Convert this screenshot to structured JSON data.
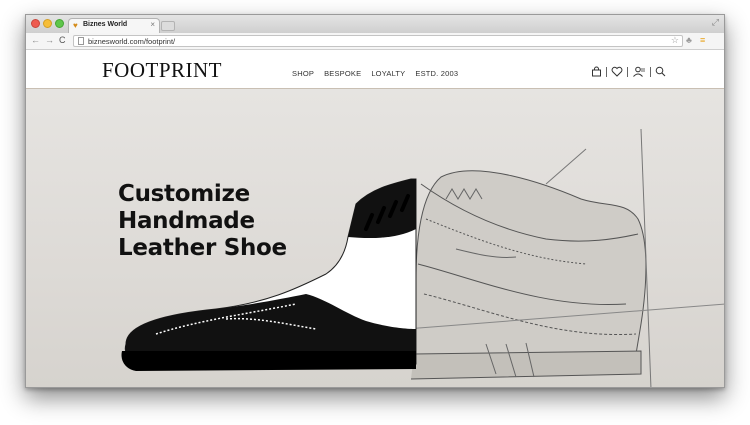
{
  "browser": {
    "tab_title": "Biznes World",
    "url": "biznesworld.com/footprint/"
  },
  "site": {
    "logo": "FOOTPRINT",
    "nav": [
      "SHOP",
      "BESPOKE",
      "LOYALTY",
      "ESTD. 2003"
    ],
    "utility_icons": [
      "bag-icon",
      "heart-icon",
      "account-icon",
      "search-icon"
    ]
  },
  "hero": {
    "headline_lines": [
      "Customize",
      "Handmade",
      "Leather Shoe"
    ]
  },
  "colors": {
    "hero_bg": "#dddad6",
    "text": "#111111",
    "extension_accent": "#e8a21a"
  }
}
